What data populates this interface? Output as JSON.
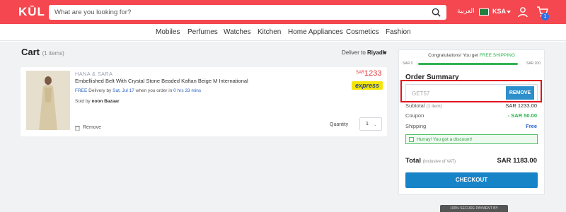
{
  "header": {
    "logo": "KŪL",
    "search_placeholder": "What are you looking for?",
    "language": "العربية",
    "country": "KSA",
    "cart_badge": "1",
    "brand_color": "#f5474f"
  },
  "nav": [
    "Mobiles",
    "Perfumes",
    "Watches",
    "Kitchen",
    "Home Appliances",
    "Cosmetics",
    "Fashion"
  ],
  "cart": {
    "title": "Cart",
    "count": "(1 items)",
    "deliver_prefix": "Deliver to",
    "deliver_city": "Riyadh"
  },
  "item": {
    "brand": "HANA & SARA",
    "name": "Embellished Belt With Crystal Stone Beaded Kaftan Beige M International",
    "delivery_free": "FREE",
    "delivery_text": "Delivery by",
    "delivery_date": "Sat, Jul 17",
    "delivery_mid": "when you order in",
    "delivery_time": "0 hrs 33 mins",
    "sold_prefix": "Sold by",
    "seller": "noon Bazaar",
    "remove": "Remove",
    "currency": "SAR",
    "price": "1233",
    "badge": "express",
    "qty_label": "Quantity",
    "qty": "1"
  },
  "summary": {
    "congrats": "Congratulations! You get",
    "free_shipping": "FREE SHIPPING",
    "bar_min": "SAR 0",
    "bar_max": "SAR 200",
    "title": "Order Summary",
    "coupon_value": "GET57",
    "remove_btn": "REMOVE",
    "subtotal_label": "Subtotal",
    "subtotal_count": "(1 item)",
    "subtotal_val": "SAR 1233.00",
    "coupon_label": "Coupon",
    "coupon_val": "- SAR 50.00",
    "shipping_label": "Shipping",
    "shipping_val": "Free",
    "discount_msg": "Hurray! You got a discount!",
    "total_label": "Total",
    "total_note": "(Inclusive of VAT)",
    "total_val": "SAR 1183.00",
    "checkout": "CHECKOUT"
  },
  "footer": {
    "secure": "100% SECURE PAYMENT BY"
  }
}
